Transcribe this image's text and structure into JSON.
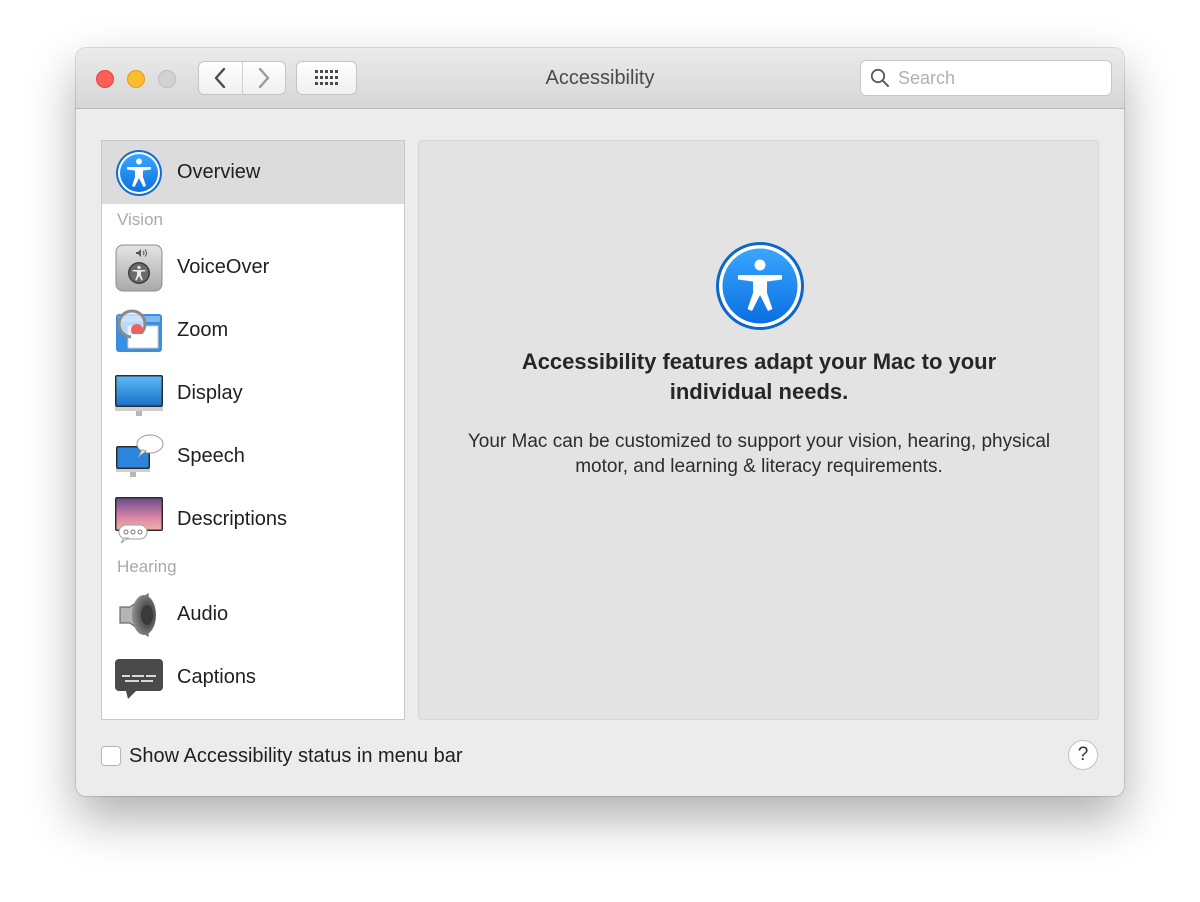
{
  "window": {
    "title": "Accessibility"
  },
  "toolbar": {
    "back_icon": "chevron-left-icon",
    "forward_icon": "chevron-right-icon",
    "grid_icon": "grid-icon"
  },
  "search": {
    "placeholder": "Search",
    "value": ""
  },
  "sidebar": {
    "overview": {
      "label": "Overview",
      "icon": "accessibility-icon",
      "selected": true
    },
    "sections": [
      {
        "title": "Vision",
        "items": [
          {
            "label": "VoiceOver",
            "icon": "voiceover-icon"
          },
          {
            "label": "Zoom",
            "icon": "zoom-icon"
          },
          {
            "label": "Display",
            "icon": "display-icon"
          },
          {
            "label": "Speech",
            "icon": "speech-icon"
          },
          {
            "label": "Descriptions",
            "icon": "descriptions-icon"
          }
        ]
      },
      {
        "title": "Hearing",
        "items": [
          {
            "label": "Audio",
            "icon": "speaker-icon"
          },
          {
            "label": "Captions",
            "icon": "captions-icon"
          }
        ]
      }
    ]
  },
  "main": {
    "icon": "accessibility-icon",
    "headline": "Accessibility features adapt your Mac to your individual needs.",
    "description": "Your Mac can be customized to support your vision, hearing, physical motor, and learning & literacy requirements."
  },
  "footer": {
    "checkbox_label": "Show Accessibility status in menu bar",
    "checkbox_checked": false,
    "help_label": "?"
  },
  "colors": {
    "accent_blue": "#1a8cf8",
    "close": "#fc5f57",
    "minimize": "#fdbc2e",
    "zoom_disabled": "#d2d2d2"
  }
}
